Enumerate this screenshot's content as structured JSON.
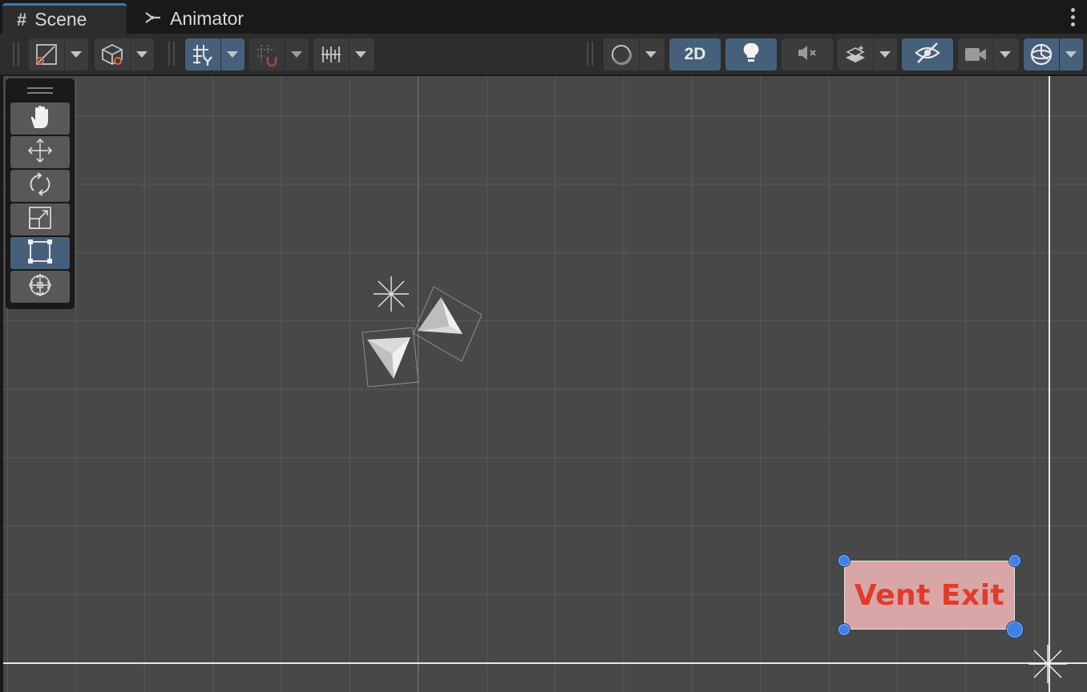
{
  "tabs": [
    {
      "label": "Scene",
      "icon": "grid-hash-icon",
      "active": true
    },
    {
      "label": "Animator",
      "icon": "animator-fork-icon",
      "active": false
    }
  ],
  "toolbar": {
    "twod_label": "2D",
    "buttons": [
      "draw-mode-icon",
      "shading-mode-icon",
      "grid-y-toggle-icon",
      "grid-snap-icon",
      "increment-snap-icon",
      "render-mode-icon",
      "lighting-icon",
      "audio-mute-icon",
      "effects-icon",
      "scene-visibility-icon",
      "camera-icon",
      "gizmos-icon"
    ]
  },
  "palette": {
    "tools": [
      "hand-tool",
      "move-tool",
      "rotate-tool",
      "scale-tool",
      "rect-tool",
      "transform-tool"
    ],
    "active": "rect-tool"
  },
  "scene": {
    "sprite_label": "Vent Exit",
    "sprite_color": "#d8a6a6",
    "label_color": "#e23a2c",
    "handle_color": "#3c82e6"
  },
  "colors": {
    "accent": "#3a79bb",
    "active_button": "#46607c"
  }
}
